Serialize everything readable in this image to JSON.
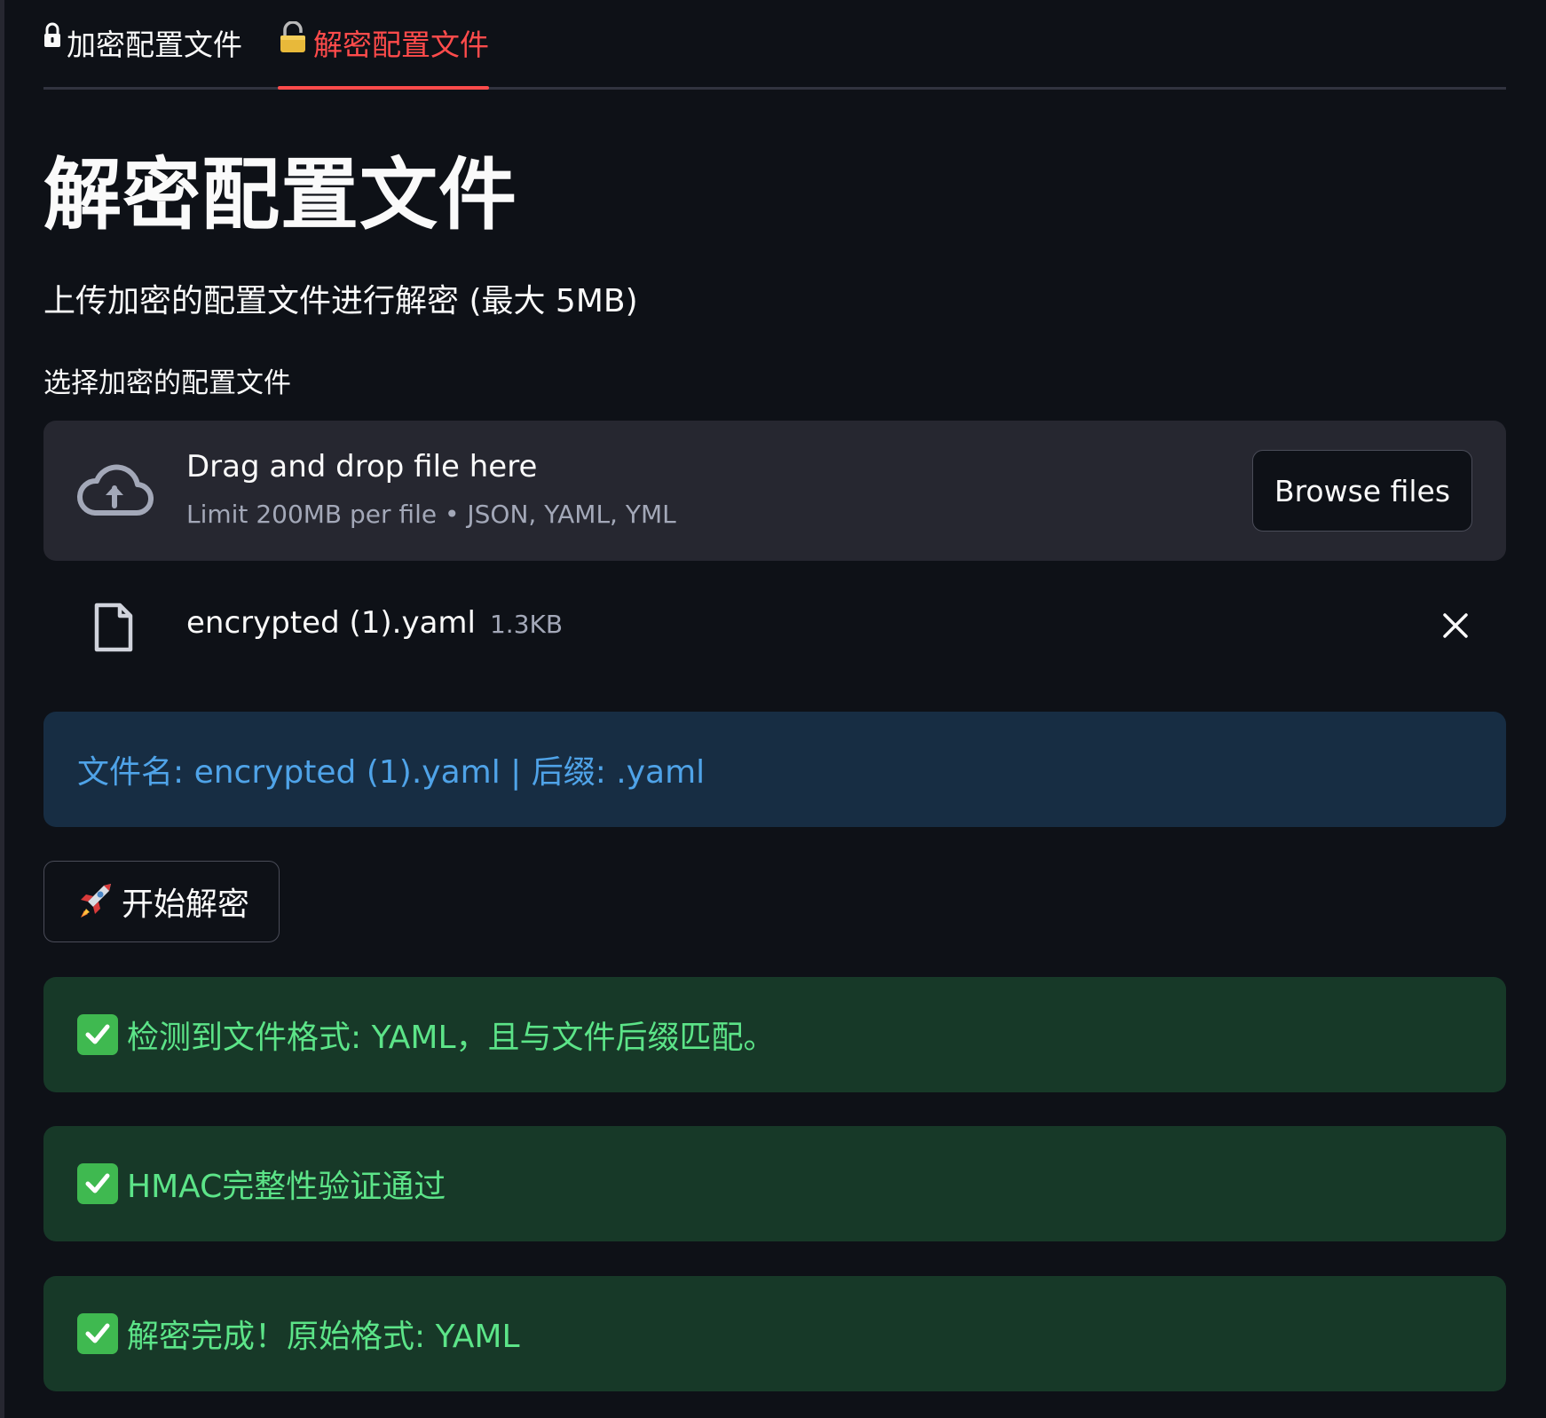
{
  "tabs": [
    {
      "label": "加密配置文件",
      "icon": "lock-icon",
      "active": false
    },
    {
      "label": "解密配置文件",
      "icon": "open-lock-icon",
      "active": true
    }
  ],
  "colors": {
    "accent": "#ff4b4b",
    "background": "#0e1117",
    "info_text": "#4fa3e8",
    "success_text": "#5ce488"
  },
  "page": {
    "title": "解密配置文件",
    "subtitle": "上传加密的配置文件进行解密 (最大 5MB)"
  },
  "uploader": {
    "label": "选择加密的配置文件",
    "drop_text": "Drag and drop file here",
    "limit_text": "Limit 200MB per file • JSON, YAML, YML",
    "browse_label": "Browse files",
    "file": {
      "name": "encrypted (1).yaml",
      "size": "1.3KB"
    }
  },
  "info_alert": "文件名: encrypted (1).yaml | 后缀: .yaml",
  "start_button": "开始解密",
  "success_alerts": [
    "检测到文件格式: YAML，且与文件后缀匹配。",
    "HMAC完整性验证通过",
    "解密完成！原始格式: YAML"
  ]
}
